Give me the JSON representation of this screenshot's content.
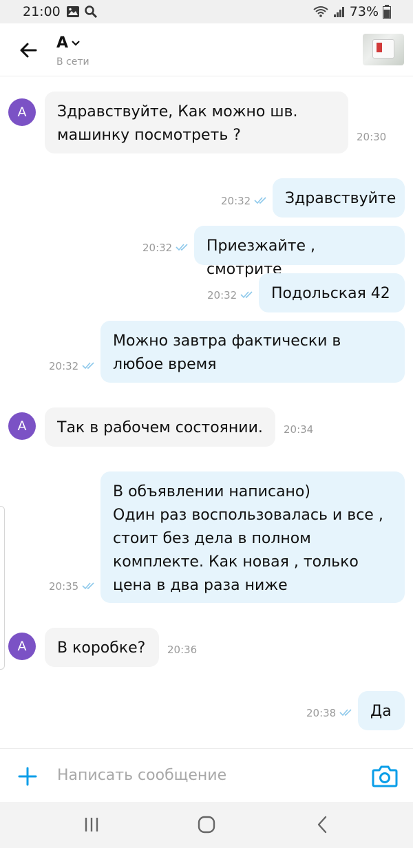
{
  "status": {
    "time": "21:00",
    "battery": "73%"
  },
  "header": {
    "contact_name": "А",
    "presence": "В сети"
  },
  "messages": [
    {
      "dir": "in",
      "avatar": "А",
      "text": "Здравствуйте, Как можно шв.\nмашинку  посмотреть ?",
      "time": "20:30"
    },
    {
      "dir": "out",
      "text": "Здравствуйте",
      "time": "20:32"
    },
    {
      "dir": "out",
      "text": "Приезжайте , смотрите",
      "time": "20:32"
    },
    {
      "dir": "out",
      "text": "Подольская 42",
      "time": "20:32"
    },
    {
      "dir": "out",
      "text": "Можно завтра фактически в\nлюбое время",
      "time": "20:32"
    },
    {
      "dir": "in",
      "avatar": "А",
      "text": "Так в рабочем состоянии.",
      "time": "20:34"
    },
    {
      "dir": "out",
      "text": "В объявлении написано)\nОдин раз воспользовалась  и все ,\nстоит без дела в полном\nкомплекте.  Как новая , только\nцена в два раза ниже",
      "time": "20:35"
    },
    {
      "dir": "in",
      "avatar": "А",
      "text": "В коробке?",
      "time": "20:36"
    },
    {
      "dir": "out",
      "text": "Да",
      "time": "20:38"
    }
  ],
  "composer": {
    "placeholder": "Написать сообщение"
  },
  "colors": {
    "accent": "#0a9ee8",
    "avatar": "#7b52c5",
    "incoming": "#f4f4f4",
    "outgoing": "#e6f4fc"
  }
}
